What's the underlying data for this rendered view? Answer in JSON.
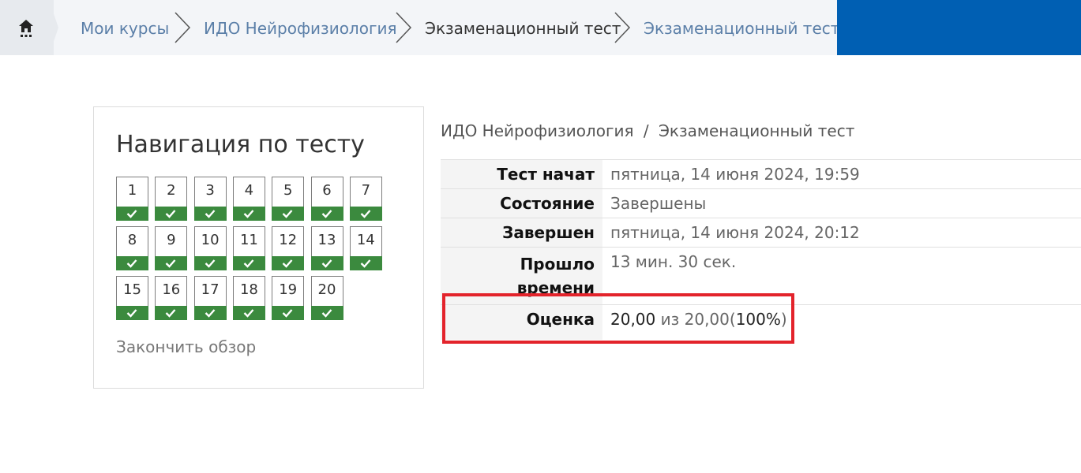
{
  "breadcrumb": {
    "home_icon": "home-icon",
    "items": [
      {
        "label": "Мои курсы"
      },
      {
        "label": "ИДО Нейрофизиология"
      },
      {
        "label": "Экзаменационный тест"
      },
      {
        "label": "Экзаменационный тест"
      }
    ]
  },
  "quiz_nav": {
    "title": "Навигация по тесту",
    "questions": [
      "1",
      "2",
      "3",
      "4",
      "5",
      "6",
      "7",
      "8",
      "9",
      "10",
      "11",
      "12",
      "13",
      "14",
      "15",
      "16",
      "17",
      "18",
      "19",
      "20"
    ],
    "state_icon": "check-icon",
    "state_color": "#3b8a3e",
    "finish_label": "Закончить обзор"
  },
  "path": {
    "course": "ИДО Нейрофизиология",
    "separator": "/",
    "quiz": "Экзаменационный тест"
  },
  "summary": {
    "started_label": "Тест начат",
    "started_value": "пятница, 14 июня 2024, 19:59",
    "state_label": "Состояние",
    "state_value": "Завершены",
    "completed_label": "Завершен",
    "completed_value": "пятница, 14 июня 2024, 20:12",
    "elapsed_label_1": "Прошло",
    "elapsed_label_2": "времени",
    "elapsed_value": "13 мин. 30 сек.",
    "grade_label": "Оценка",
    "grade_score": "20,00",
    "grade_of": "из 20,00",
    "grade_percent": "100%"
  },
  "colors": {
    "accent_blue": "#005fb3",
    "highlight_red": "#e3232b"
  }
}
